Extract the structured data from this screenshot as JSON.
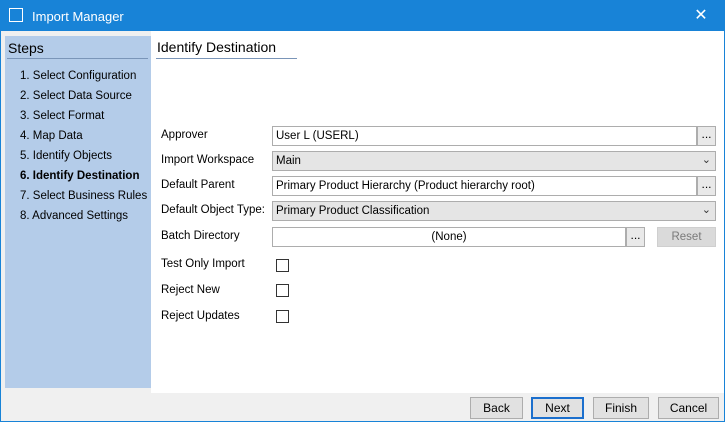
{
  "window": {
    "title": "Import Manager",
    "icon": "window-icon",
    "close_label": "✕"
  },
  "sidebar": {
    "title": "Steps",
    "steps": [
      "1. Select Configuration",
      "2. Select Data Source",
      "3. Select Format",
      "4. Map Data",
      "5. Identify Objects",
      "6. Identify Destination",
      "7. Select Business Rules",
      "8. Advanced Settings"
    ],
    "current_step": 6
  },
  "main": {
    "title": "Identify Destination",
    "fields": {
      "approver": {
        "label": "Approver",
        "value": "User L (USERL)",
        "browse": "..."
      },
      "import_workspace": {
        "label": "Import Workspace",
        "value": "Main"
      },
      "default_parent": {
        "label": "Default Parent",
        "value": "Primary Product Hierarchy (Product hierarchy root)",
        "browse": "..."
      },
      "default_object_type": {
        "label": "Default Object Type:",
        "value": "Primary Product Classification"
      },
      "batch_directory": {
        "label": "Batch Directory",
        "value": "(None)",
        "browse": "...",
        "reset": "Reset"
      },
      "test_only_import": {
        "label": "Test Only Import",
        "checked": false
      },
      "reject_new": {
        "label": "Reject New",
        "checked": false
      },
      "reject_updates": {
        "label": "Reject Updates",
        "checked": false
      }
    }
  },
  "footer": {
    "back": "Back",
    "next": "Next",
    "finish": "Finish",
    "cancel": "Cancel"
  },
  "colors": {
    "titlebar": "#1883d7",
    "sidebar": "#b4cce9",
    "default_button_border": "#1b6fcd"
  }
}
